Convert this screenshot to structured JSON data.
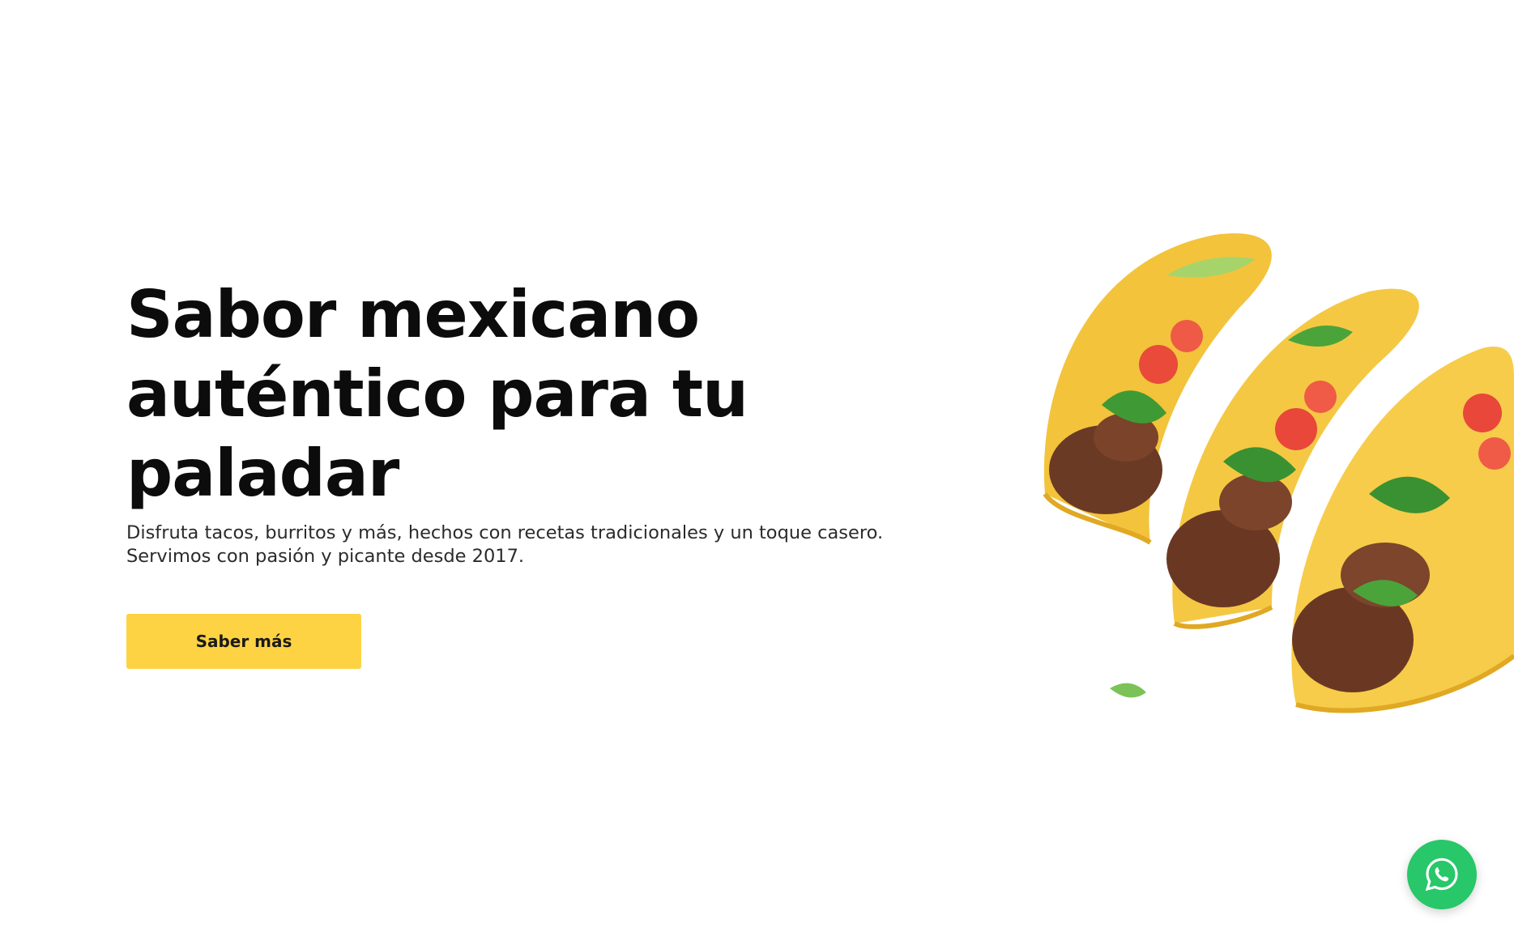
{
  "hero": {
    "title": "Sabor mexicano auténtico para tu paladar",
    "subtitle": "Disfruta tacos, burritos y más, hechos con recetas tradicionales y un toque casero. Servimos con pasión y picante desde 2017.",
    "cta_label": "Saber más"
  },
  "image": {
    "subject": "tacos-photo"
  },
  "floating": {
    "whatsapp_icon": "whatsapp-icon"
  },
  "colors": {
    "accent": "#fdd343",
    "whatsapp": "#28c76a",
    "text": "#0c0c0c"
  }
}
